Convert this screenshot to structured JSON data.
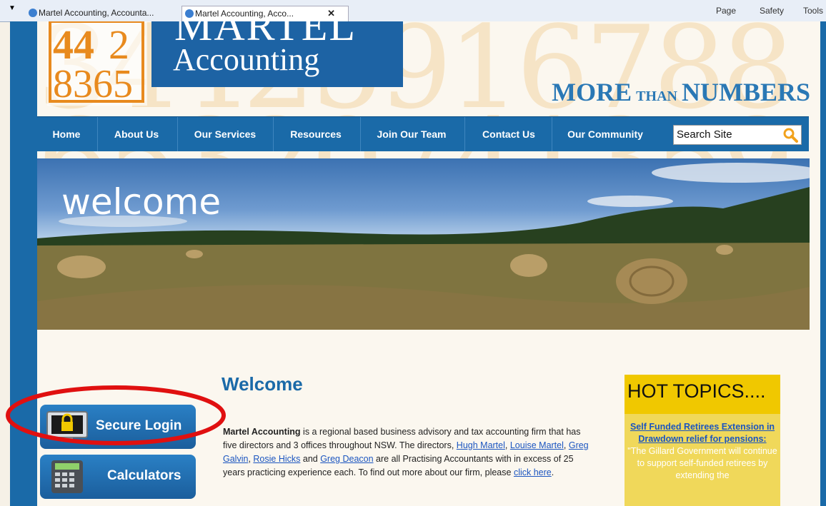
{
  "browser": {
    "tabs": [
      {
        "label": "Martel Accounting, Accounta..."
      },
      {
        "label": "Martel Accounting, Acco..."
      }
    ],
    "toolbar": {
      "page": "Page",
      "safety": "Safety",
      "tools": "Tools"
    }
  },
  "header": {
    "logo_name": "MARTEL",
    "logo_sub": "Accounting",
    "logo_digits": "4412836 5",
    "tagline_more": "MORE",
    "tagline_than": "THAN",
    "tagline_numbers": "NUMBERS"
  },
  "nav": {
    "items": [
      "Home",
      "About Us",
      "Our Services",
      "Resources",
      "Join Our Team",
      "Contact Us",
      "Our Community"
    ],
    "search_placeholder": "Search Site"
  },
  "banner": {
    "word": "welcome"
  },
  "sidebar": {
    "secure_login": "Secure Login",
    "calculators": "Calculators"
  },
  "main": {
    "title": "Welcome",
    "firm_name": "Martel Accounting",
    "p1": " is a regional based business advisory and tax accounting firm that has five directors and 3 offices throughout NSW. The directors, ",
    "directors": [
      "Hugh Martel",
      "Louise Martel",
      "Greg Galvin",
      "Rosie Hicks",
      "Greg Deacon"
    ],
    "sep1": ", ",
    "and": " and ",
    "p2": " are all Practising Accountants with in excess of 25 years practicing experience each. To find out more about our firm, please ",
    "click_here": "click here",
    "p3": "."
  },
  "hot_topics": {
    "title": "HOT TOPICS....",
    "link": "Self Funded Retirees Extension in Drawdown relief for pensions:",
    "quote": "\"The Gillard Government will continue to support self-funded retirees by extending the"
  },
  "colors": {
    "brand_blue": "#1a6aa8",
    "orange": "#e88a1e",
    "hot_yellow": "#f0c800",
    "annotation_red": "#e01010"
  }
}
